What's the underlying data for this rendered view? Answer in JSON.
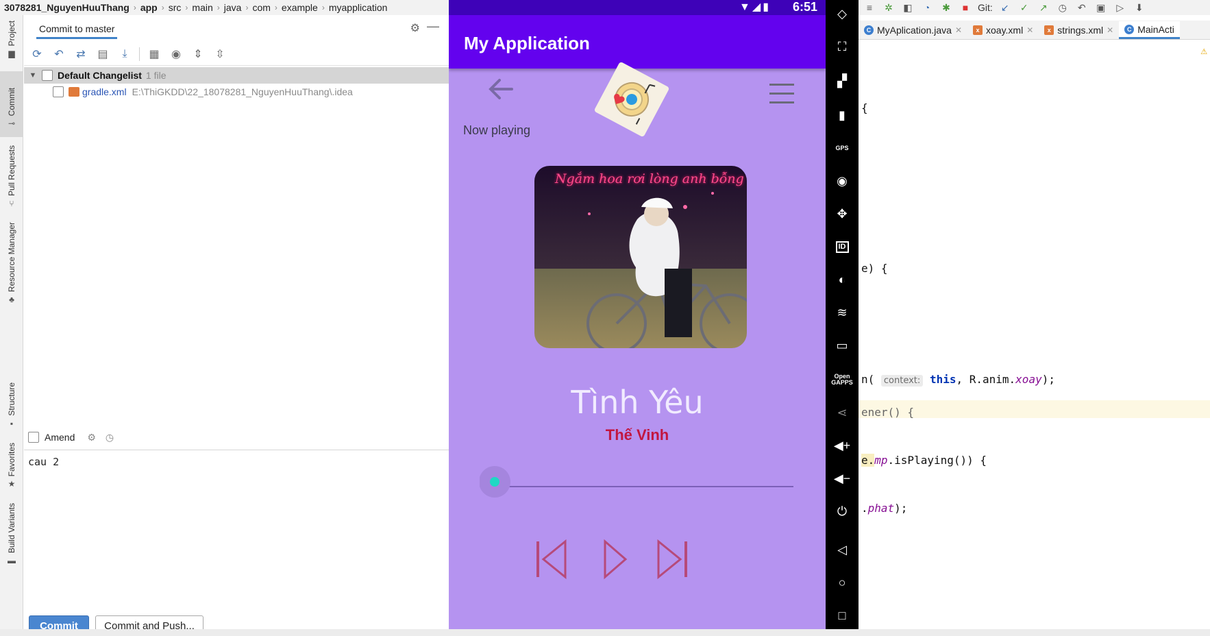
{
  "ide": {
    "breadcrumb": [
      "3078281_NguyenHuuThang",
      "app",
      "src",
      "main",
      "java",
      "com",
      "example",
      "myapplication"
    ],
    "side_tabs": [
      "Project",
      "Commit",
      "Pull Requests",
      "Resource Manager",
      "Structure",
      "Favorites",
      "Build Variants"
    ],
    "commit_panel": {
      "tab_label": "Commit to master",
      "changelist_name": "Default Changelist",
      "changelist_count": "1 file",
      "file_name": "gradle.xml",
      "file_path": "E:\\ThiGKDD\\22_18078281_NguyenHuuThang\\.idea",
      "amend_label": "Amend",
      "commit_message": "cau 2",
      "commit_button": "Commit",
      "commit_push_button": "Commit and Push..."
    },
    "right_toolbar": {
      "git_label": "Git:"
    },
    "file_tabs": [
      "MyAplication.java",
      "xoay.xml",
      "strings.xml",
      "MainActi"
    ],
    "editor": {
      "line1": "{",
      "line2": "e) {",
      "line3_a": "n(",
      "line3_hint": "context:",
      "line3_kw": "this",
      "line3_b": ", R.anim.",
      "line3_fld": "xoay",
      "line3_c": ");",
      "line4": "ener() {",
      "line5_a": "e.",
      "line5_fld": "mp",
      "line5_b": ".isPlaying()) {",
      "line6_a": ".",
      "line6_fld": "phat",
      "line6_b": ");"
    }
  },
  "phone": {
    "status_time": "6:51",
    "app_title": "My Application",
    "now_playing": "Now playing",
    "cover_caption": "Ngắm hoa rơi lòng anh bỗng nhớ",
    "song_title": "Tình Yêu",
    "artist": "Thế Vinh",
    "progress": 0.0
  },
  "emulator_toolbar": {
    "gps_label": "GPS",
    "id_label": "ID",
    "open_gapps_label": "Open GAPPS"
  },
  "colors": {
    "app_bar": "#6302ee",
    "status_bar": "#3e02b8",
    "phone_bg": "#b593f0",
    "artist": "#c2163f",
    "seek_thumb": "#1fd8c4",
    "controls": "#b64a7a"
  }
}
